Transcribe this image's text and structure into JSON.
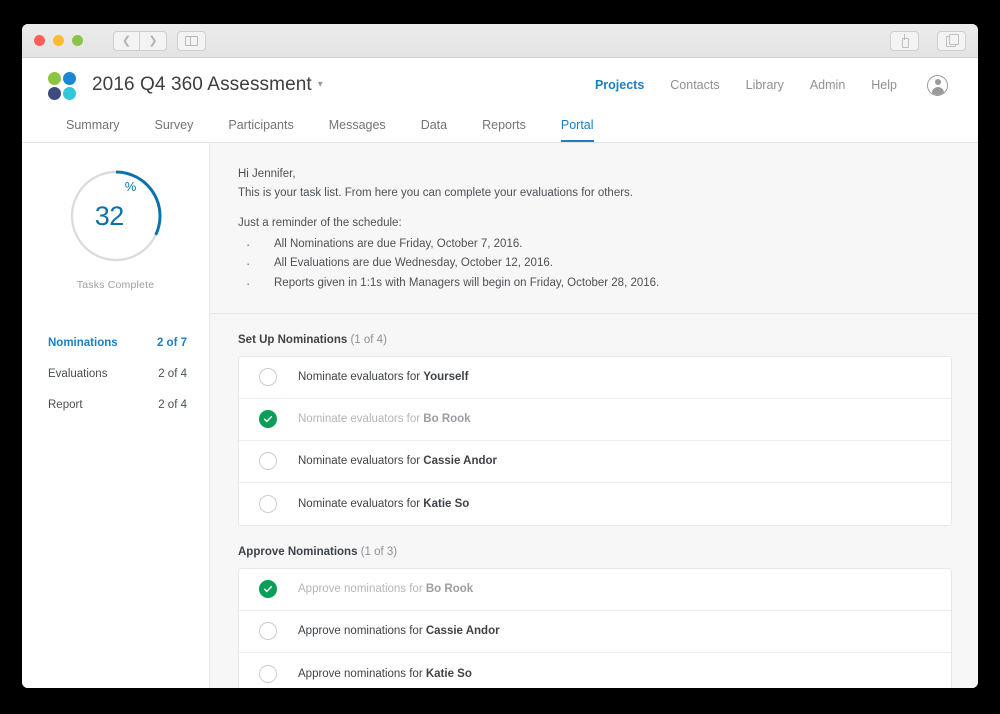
{
  "window": {
    "traffic_lights": [
      "close",
      "minimize",
      "maximize"
    ],
    "nav_back_icon": "chevron-left-icon",
    "nav_forward_icon": "chevron-right-icon",
    "sidebar_toggle_icon": "sidebar-toggle-icon",
    "share_icon": "share-icon",
    "tabs_icon": "show-tabs-icon"
  },
  "header": {
    "logo_icon": "four-dot-logo-icon",
    "logo_colors": {
      "top_left": "#8cc63f",
      "top_right": "#1b87d2",
      "bottom_left": "#3d4c7e",
      "bottom_right": "#35c6d8"
    },
    "title": "2016 Q4 360 Assessment",
    "title_caret_icon": "chevron-down-icon",
    "nav": [
      {
        "label": "Projects",
        "active": true
      },
      {
        "label": "Contacts",
        "active": false
      },
      {
        "label": "Library",
        "active": false
      },
      {
        "label": "Admin",
        "active": false
      },
      {
        "label": "Help",
        "active": false
      }
    ],
    "avatar_icon": "user-avatar-icon",
    "accent_color": "#1b7fc4"
  },
  "tabs": [
    {
      "label": "Summary",
      "active": false
    },
    {
      "label": "Survey",
      "active": false
    },
    {
      "label": "Participants",
      "active": false
    },
    {
      "label": "Messages",
      "active": false
    },
    {
      "label": "Data",
      "active": false
    },
    {
      "label": "Reports",
      "active": false
    },
    {
      "label": "Portal",
      "active": true
    }
  ],
  "sidebar": {
    "progress": {
      "value": 32,
      "unit": "%",
      "caption": "Tasks Complete",
      "arc_color": "#0d72a8",
      "track_color": "#dcdcdc"
    },
    "items": [
      {
        "label": "Nominations",
        "count": "2 of 7",
        "active": true
      },
      {
        "label": "Evaluations",
        "count": "2 of 4",
        "active": false
      },
      {
        "label": "Report",
        "count": "2 of 4",
        "active": false
      }
    ]
  },
  "intro": {
    "greeting": "Hi Jennifer,",
    "line1": "This is your task list. From here you can complete your evaluations for others.",
    "schedule_title": "Just a reminder of the schedule:",
    "bullets": [
      "All Nominations are due Friday, October 7, 2016.",
      "All Evaluations are due Wednesday, October 12, 2016.",
      "Reports given in 1:1s with Managers will begin on Friday, October 28, 2016."
    ]
  },
  "sections": [
    {
      "title": "Set Up Nominations",
      "count": "(1 of 4)",
      "tasks": [
        {
          "prefix": "Nominate evaluators for ",
          "name": "Yourself",
          "done": false
        },
        {
          "prefix": "Nominate evaluators for ",
          "name": "Bo Rook",
          "done": true
        },
        {
          "prefix": "Nominate evaluators for ",
          "name": "Cassie Andor",
          "done": false
        },
        {
          "prefix": "Nominate evaluators for ",
          "name": "Katie So",
          "done": false
        }
      ]
    },
    {
      "title": "Approve Nominations",
      "count": "(1 of 3)",
      "tasks": [
        {
          "prefix": "Approve nominations for ",
          "name": "Bo Rook",
          "done": true
        },
        {
          "prefix": "Approve nominations for ",
          "name": "Cassie Andor",
          "done": false
        },
        {
          "prefix": "Approve nominations for ",
          "name": "Katie So",
          "done": false
        }
      ]
    }
  ],
  "colors": {
    "done_green": "#0a9e58",
    "accent_blue": "#1b7fc4",
    "main_bg": "#f7f7f7"
  }
}
